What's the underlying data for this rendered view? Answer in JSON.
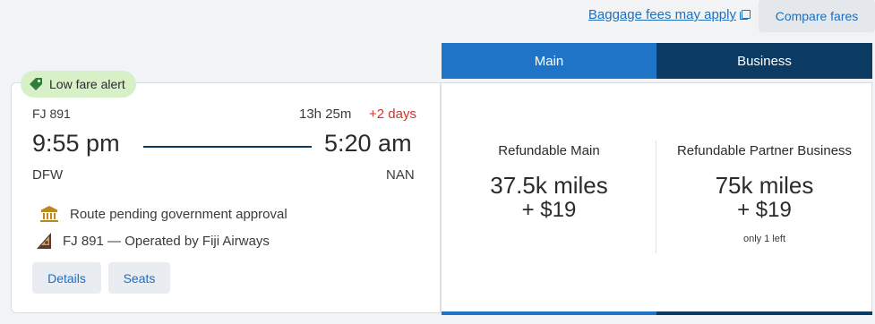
{
  "header": {
    "baggage_link": "Baggage fees may apply",
    "compare_button": "Compare fares"
  },
  "tabs": [
    {
      "label": "Main"
    },
    {
      "label": "Business"
    }
  ],
  "flight": {
    "alert": "Low fare alert",
    "flight_number": "FJ 891",
    "duration": "13h 25m",
    "days_offset": "+2 days",
    "departure_time": "9:55 pm",
    "arrival_time": "5:20 am",
    "departure_airport": "DFW",
    "arrival_airport": "NAN",
    "notice": "Route pending government approval",
    "operated_by": "FJ 891 — Operated by Fiji Airways",
    "details_button": "Details",
    "seats_button": "Seats"
  },
  "fares": [
    {
      "name": "Refundable Main",
      "miles": "37.5k miles",
      "cash": "+ $19",
      "note": ""
    },
    {
      "name": "Refundable Partner Business",
      "miles": "75k miles",
      "cash": "+ $19",
      "note": "only 1 left"
    }
  ],
  "colors": {
    "main_tab": "#1f74c8",
    "business_tab": "#0b3a63",
    "link": "#1d6fbf",
    "alert_bg": "#d8f0c8",
    "days_offset": "#d0342c"
  },
  "icons": [
    "external-link-icon",
    "tag-icon",
    "government-building-icon",
    "fiji-airways-logo-icon"
  ]
}
